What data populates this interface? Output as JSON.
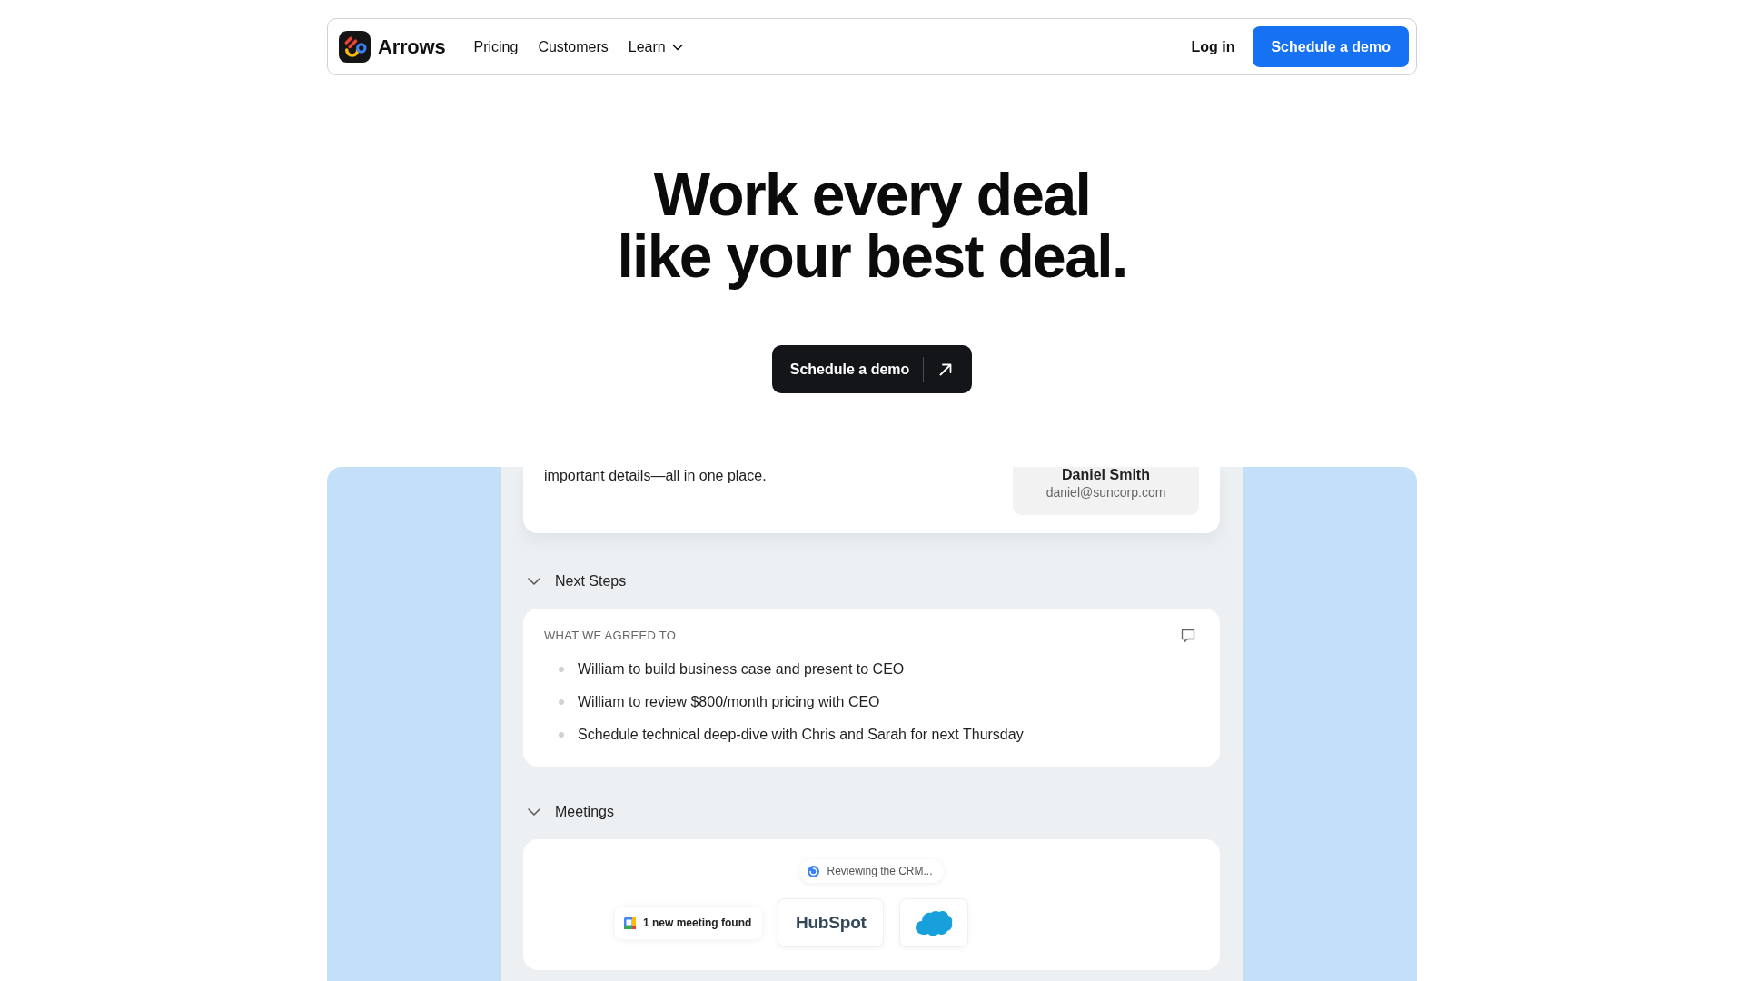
{
  "navbar": {
    "brand": "Arrows",
    "links": [
      {
        "label": "Pricing",
        "kind": "link"
      },
      {
        "label": "Customers",
        "kind": "link"
      },
      {
        "label": "Learn",
        "kind": "dropdown"
      }
    ],
    "login": "Log in",
    "cta": "Schedule a demo"
  },
  "hero": {
    "headline_lines": [
      "Work every deal",
      "like your best deal."
    ],
    "cta": "Schedule a demo"
  },
  "demo": {
    "summary_card": {
      "text": "important details—all in one place.",
      "contact": {
        "name": "Daniel Smith",
        "email": "daniel@suncorp.com"
      }
    },
    "sections": [
      {
        "kind": "next_steps",
        "title": "Next Steps",
        "expanded": true,
        "label": "WHAT WE AGREED TO",
        "items": [
          "William to build business case and present to CEO",
          "William to review $800/month pricing with CEO",
          "Schedule technical deep-dive with Chris and Sarah for next Thursday"
        ]
      },
      {
        "kind": "meetings",
        "title": "Meetings",
        "expanded": true,
        "status": "Reviewing the CRM...",
        "found": "1 new meeting found",
        "crm_tiles": [
          {
            "kind": "wordmark",
            "text": "HubSpot"
          },
          {
            "kind": "cloud"
          }
        ]
      }
    ]
  }
}
